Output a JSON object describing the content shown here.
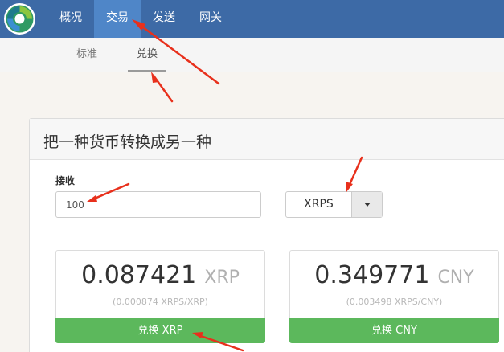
{
  "nav": {
    "items": [
      {
        "label": "概况",
        "active": false
      },
      {
        "label": "交易",
        "active": true
      },
      {
        "label": "发送",
        "active": false
      },
      {
        "label": "网关",
        "active": false
      }
    ]
  },
  "subnav": {
    "items": [
      {
        "label": "标准",
        "active": false
      },
      {
        "label": "兑换",
        "active": true
      }
    ]
  },
  "panel": {
    "title": "把一种货币转换成另一种",
    "receive_label": "接收",
    "amount_value": "100",
    "currency_selected": "XRPS"
  },
  "quotes": [
    {
      "value": "0.087421",
      "unit": "XRP",
      "rate": "(0.000874 XRPS/XRP)",
      "button_label": "兑换 XRP"
    },
    {
      "value": "0.349771",
      "unit": "CNY",
      "rate": "(0.003498 XRPS/CNY)",
      "button_label": "兑换 CNY"
    }
  ],
  "colors": {
    "topbar": "#3d6aa6",
    "nav_active": "#4f86c8",
    "button_green": "#5cb85c",
    "annotation_arrow": "#e8301c"
  }
}
